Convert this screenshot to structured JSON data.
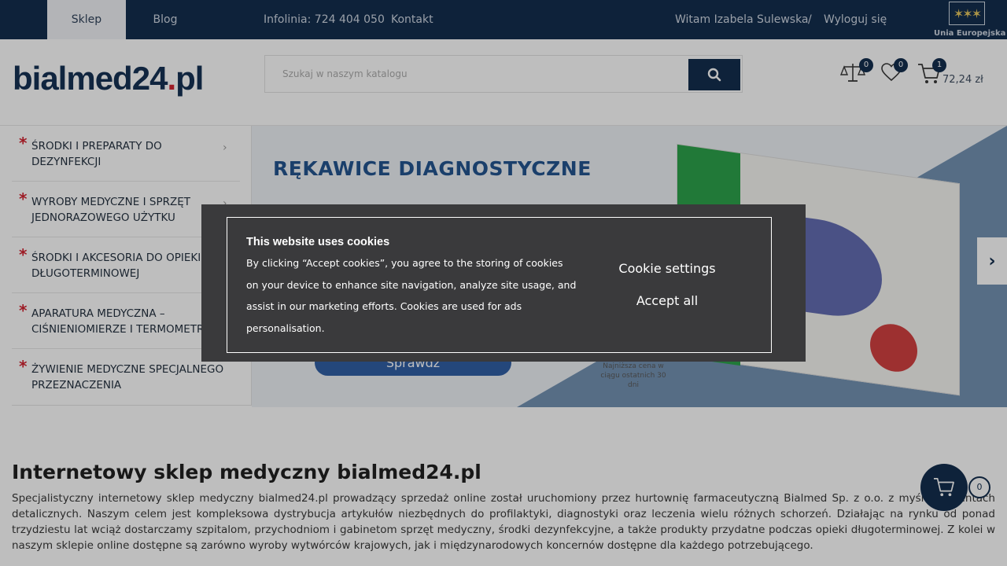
{
  "topbar": {
    "tabs": [
      {
        "label": "Sklep"
      },
      {
        "label": "Blog"
      }
    ],
    "infoline": "Infolinia: 724 404 050",
    "contact": "Kontakt",
    "greeting": "Witam Izabela Sulewska",
    "separator": "/",
    "logout": "Wyloguj się",
    "eu_label": "Unia Europejska"
  },
  "header": {
    "logo_main": "bialmed24",
    "logo_dot": ".",
    "logo_tld": "pl",
    "search_placeholder": "Szukaj w naszym katalogu",
    "compare_count": "0",
    "wishlist_count": "0",
    "cart_count": "1",
    "cart_total": "72,24 zł"
  },
  "sidebar": {
    "items": [
      {
        "label": "ŚRODKI I PREPARATY DO DEZYNFEKCJI"
      },
      {
        "label": "WYROBY MEDYCZNE I SPRZĘT JEDNORAZOWEGO UŻYTKU"
      },
      {
        "label": "ŚRODKI I AKCESORIA DO OPIEKI DŁUGOTERMINOWEJ"
      },
      {
        "label": "APARATURA MEDYCZNA – CIŚNIENIOMIERZE I TERMOMETRY"
      },
      {
        "label": "ŻYWIENIE MEDYCZNE SPECJALNEGO PRZEZNACZENIA"
      }
    ]
  },
  "banner": {
    "title": "RĘKAWICE DIAGNOSTYCZNE",
    "button": "Sprawdź",
    "price_note": "Najniższa cena w ciągu ostatnich 30 dni"
  },
  "content": {
    "title": "Internetowy sklep medyczny bialmed24.pl",
    "text": "Specjalistyczny internetowy sklep medyczny bialmed24.pl prowadzący sprzedaż online został uruchomiony przez hurtownię farmaceutyczną Bialmed Sp. z o.o. z myślą o klientach detalicznych. Naszym celem jest kompleksowa dystrybucja artykułów niezbędnych do profilaktyki, diagnostyki oraz leczenia wielu różnych schorzeń. Działając na rynku od ponad trzydziestu lat wciąż dostarczamy szpitalom, przychodniom i gabinetom sprzęt medyczny, środki dezynfekcyjne, a także produkty przydatne podczas opieki długoterminowej. Z kolei w naszym sklepie online dostępne są zarówno wyroby wytwórców krajowych, jak i międzynarodowych koncernów dostępne dla każdego potrzebującego.",
    "float_cart_count": "0"
  },
  "cookie": {
    "title": "This website uses cookies",
    "text": "By clicking “Accept cookies”, you agree to the storing of cookies on your device to enhance site navigation, analyze site usage, and assist in our marketing efforts. Cookies are used for ads personalisation.",
    "settings_label": "Cookie settings",
    "accept_label": "Accept all"
  },
  "colors": {
    "navy": "#0c2748",
    "accent_red": "#d21e2b",
    "banner_blue": "#1d4f8c",
    "dialog_bg": "#3a3a3c"
  }
}
